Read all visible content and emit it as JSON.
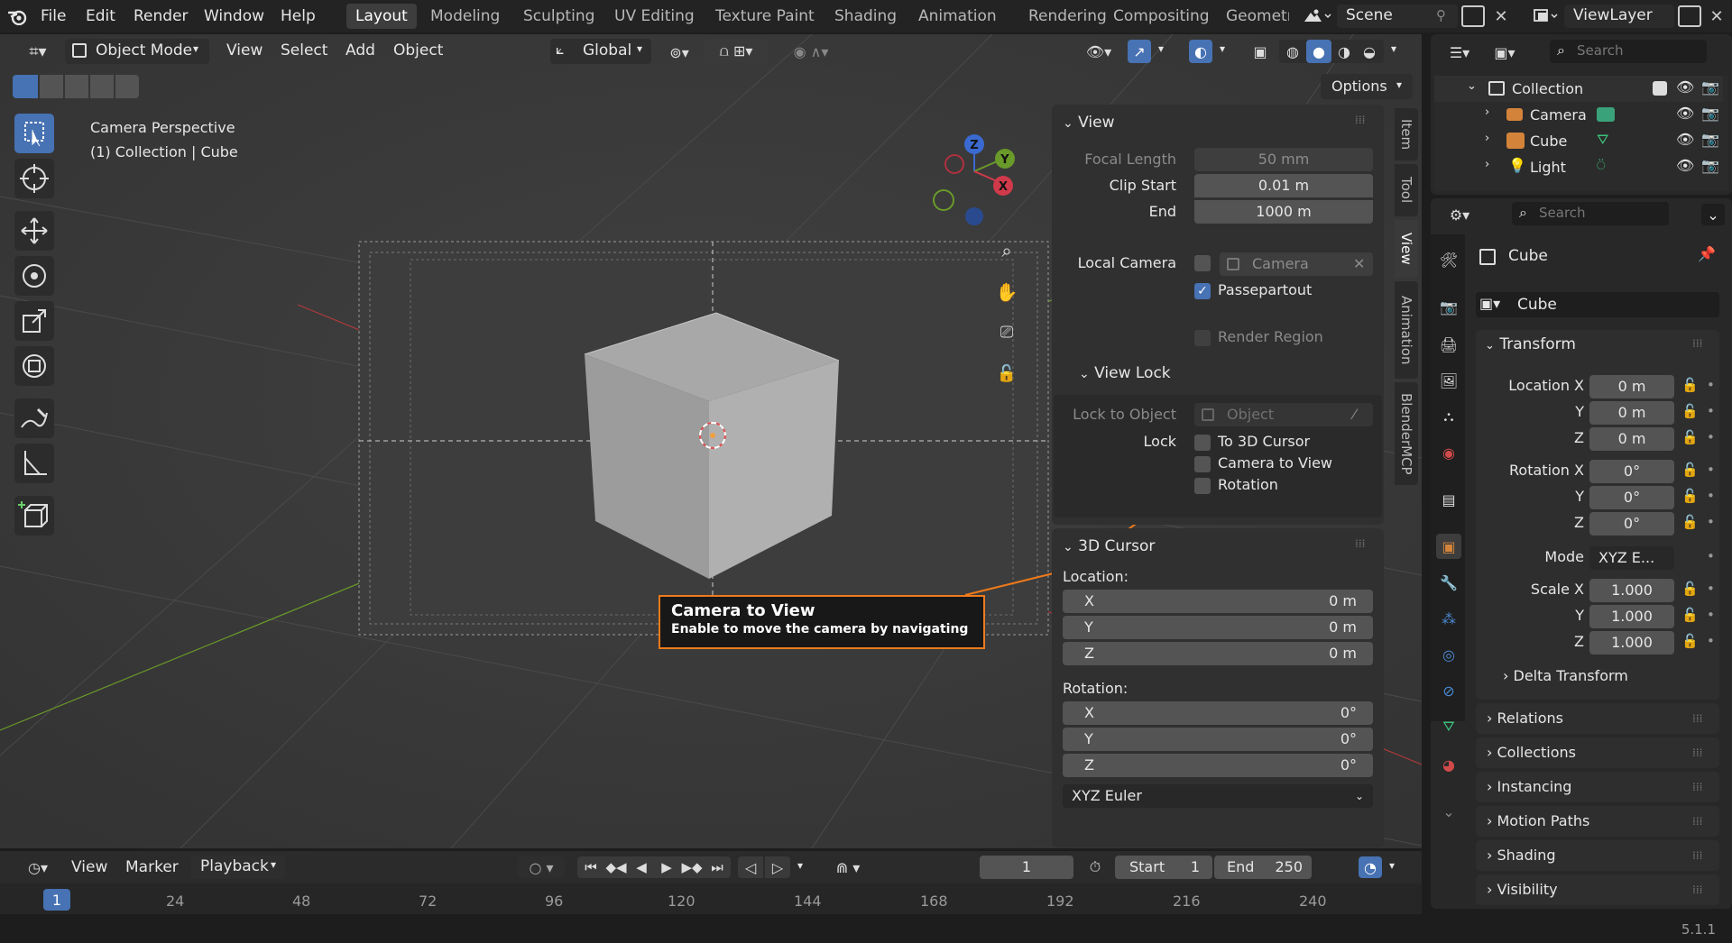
{
  "topbar": {
    "menus": [
      "File",
      "Edit",
      "Render",
      "Window",
      "Help"
    ],
    "workspaces": [
      "Layout",
      "Modeling",
      "Sculpting",
      "UV Editing",
      "Texture Paint",
      "Shading",
      "Animation",
      "Rendering",
      "Compositing",
      "Geometr"
    ],
    "active_workspace": "Layout",
    "scene": "Scene",
    "view_layer": "ViewLayer"
  },
  "viewport_header": {
    "mode": "Object Mode",
    "menus": [
      "View",
      "Select",
      "Add",
      "Object"
    ],
    "orientation": "Global",
    "options": "Options"
  },
  "viewport": {
    "overlay_line1": "Camera Perspective",
    "overlay_line2": "(1) Collection | Cube",
    "gizmo_labels": {
      "z": "Z",
      "y": "Y",
      "x": "X"
    }
  },
  "tooltip": {
    "title": "Camera to View",
    "description": "Enable to move the camera by navigating"
  },
  "npanel": {
    "tabs": [
      "Item",
      "Tool",
      "View",
      "Animation",
      "BlenderMCP"
    ],
    "active_tab": "View",
    "view_section": {
      "title": "View",
      "focal_length_label": "Focal Length",
      "focal_length": "50 mm",
      "clip_start_label": "Clip Start",
      "clip_start": "0.01 m",
      "end_label": "End",
      "end": "1000 m",
      "local_camera_label": "Local Camera",
      "local_camera_value": "Camera",
      "passepartout_label": "Passepartout",
      "render_region_label": "Render Region"
    },
    "view_lock": {
      "title": "View Lock",
      "lock_to_object_label": "Lock to Object",
      "lock_to_object_placeholder": "Object",
      "lock_label": "Lock",
      "to_3d_cursor": "To 3D Cursor",
      "camera_to_view": "Camera to View",
      "rotation": "Rotation"
    },
    "cursor_section": {
      "title": "3D Cursor",
      "location_label": "Location:",
      "loc": [
        {
          "axis": "X",
          "value": "0 m"
        },
        {
          "axis": "Y",
          "value": "0 m"
        },
        {
          "axis": "Z",
          "value": "0 m"
        }
      ],
      "rotation_label": "Rotation:",
      "rot": [
        {
          "axis": "X",
          "value": "0°"
        },
        {
          "axis": "Y",
          "value": "0°"
        },
        {
          "axis": "Z",
          "value": "0°"
        }
      ],
      "rotation_mode": "XYZ Euler"
    }
  },
  "outliner": {
    "search_placeholder": "Search",
    "collection": "Collection",
    "items": [
      "Camera",
      "Cube",
      "Light"
    ]
  },
  "properties": {
    "search_placeholder": "Search",
    "object_name": "Cube",
    "object_field": "Cube",
    "transform": {
      "title": "Transform",
      "location_label": "Location X",
      "location": [
        "0 m",
        "0 m",
        "0 m"
      ],
      "rotation_label": "Rotation X",
      "rotation": [
        "0°",
        "0°",
        "0°"
      ],
      "mode_label": "Mode",
      "mode_value": "XYZ E...",
      "scale_label": "Scale X",
      "scale": [
        "1.000",
        "1.000",
        "1.000"
      ],
      "y": "Y",
      "z": "Z"
    },
    "delta_transform": "Delta Transform",
    "sections": [
      "Relations",
      "Collections",
      "Instancing",
      "Motion Paths",
      "Shading",
      "Visibility"
    ]
  },
  "timeline": {
    "menus": [
      "View",
      "Marker"
    ],
    "playback": "Playback",
    "current_frame": "1",
    "start_label": "Start",
    "start": "1",
    "end_label": "End",
    "end": "250",
    "ruler": [
      "24",
      "48",
      "72",
      "96",
      "120",
      "144",
      "168",
      "192",
      "216",
      "240"
    ],
    "current_marker": "1"
  },
  "statusbar": {
    "version": "5.1.1"
  }
}
